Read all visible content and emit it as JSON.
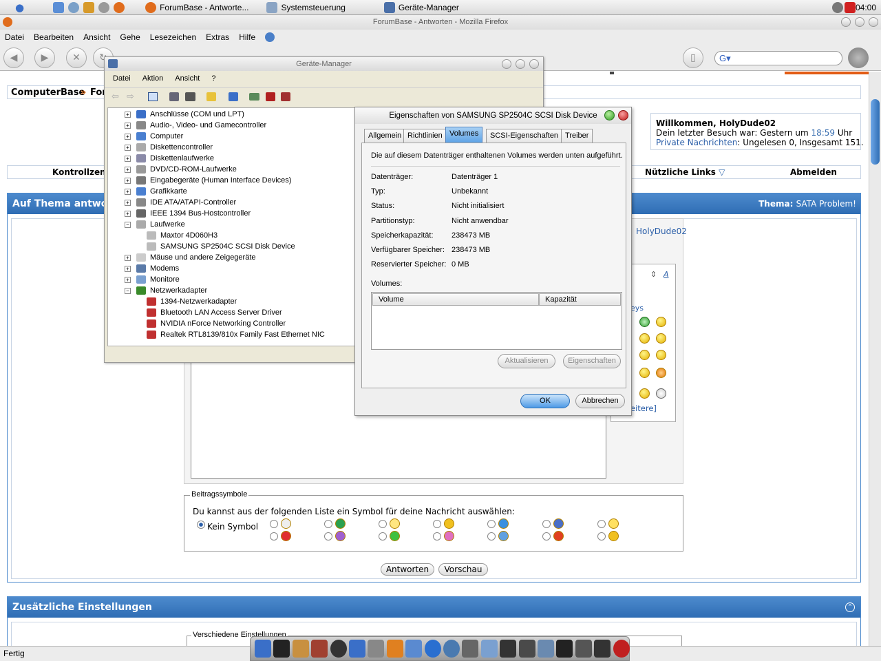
{
  "topbar": {
    "tasks": [
      "ForumBase - Antworte...",
      "Systemsteuerung",
      "Geräte-Manager"
    ],
    "clock": "04:00"
  },
  "firefox": {
    "title": "ForumBase - Antworten - Mozilla Firefox",
    "menu": [
      "Datei",
      "Bearbeiten",
      "Ansicht",
      "Gehe",
      "Lesezeichen",
      "Extras",
      "Hilfe"
    ],
    "status": "Fertig"
  },
  "forum": {
    "breadcrumb_site": "ComputerBase",
    "breadcrumb_sep": "»",
    "breadcrumb_next": "For",
    "welcome_title": "Willkommen, HolyDude02",
    "last_visit_prefix": "Dein letzter Besuch war: Gestern um ",
    "last_visit_time": "18:59",
    "last_visit_suffix": " Uhr",
    "pm_link": "Private Nachrichten",
    "pm_info": ": Ungelesen 0, Insgesamt 151.",
    "nav_left": "Kontrollzentr",
    "nav_links": "Nützliche Links",
    "nav_logout": "Abmelden",
    "reply_header": "Auf Thema antwor",
    "thema_label": "Thema:",
    "thema_value": "SATA Problem!",
    "user_link": "HolyDude02",
    "smilies_label": "eys",
    "more_link": "eitere]",
    "symbols_legend": "Beitragssymbole",
    "symbols_instruction": "Du kannst aus der folgenden Liste ein Symbol für deine Nachricht auswählen:",
    "no_symbol": "Kein Symbol",
    "reply_button": "Antworten",
    "preview_button": "Vorschau",
    "extra_settings": "Zusätzliche Einstellungen",
    "misc_settings": "Verschiedene Einstellungen"
  },
  "devmgr": {
    "title": "Geräte-Manager",
    "menu": [
      "Datei",
      "Aktion",
      "Ansicht",
      "?"
    ],
    "tree": [
      {
        "label": "Anschlüsse (COM und LPT)",
        "level": 0,
        "exp": "+"
      },
      {
        "label": "Audio-, Video- und Gamecontroller",
        "level": 0,
        "exp": "+"
      },
      {
        "label": "Computer",
        "level": 0,
        "exp": "+"
      },
      {
        "label": "Diskettencontroller",
        "level": 0,
        "exp": "+"
      },
      {
        "label": "Diskettenlaufwerke",
        "level": 0,
        "exp": "+"
      },
      {
        "label": "DVD/CD-ROM-Laufwerke",
        "level": 0,
        "exp": "+"
      },
      {
        "label": "Eingabegeräte (Human Interface Devices)",
        "level": 0,
        "exp": "+"
      },
      {
        "label": "Grafikkarte",
        "level": 0,
        "exp": "+"
      },
      {
        "label": "IDE ATA/ATAPI-Controller",
        "level": 0,
        "exp": "+"
      },
      {
        "label": "IEEE 1394 Bus-Hostcontroller",
        "level": 0,
        "exp": "+"
      },
      {
        "label": "Laufwerke",
        "level": 0,
        "exp": "−"
      },
      {
        "label": "Maxtor 4D060H3",
        "level": 1,
        "exp": ""
      },
      {
        "label": "SAMSUNG SP2504C SCSI Disk Device",
        "level": 1,
        "exp": ""
      },
      {
        "label": "Mäuse und andere Zeigegeräte",
        "level": 0,
        "exp": "+"
      },
      {
        "label": "Modems",
        "level": 0,
        "exp": "+"
      },
      {
        "label": "Monitore",
        "level": 0,
        "exp": "+"
      },
      {
        "label": "Netzwerkadapter",
        "level": 0,
        "exp": "−"
      },
      {
        "label": "1394-Netzwerkadapter",
        "level": 1,
        "exp": ""
      },
      {
        "label": "Bluetooth LAN Access Server Driver",
        "level": 1,
        "exp": ""
      },
      {
        "label": "NVIDIA nForce Networking Controller",
        "level": 1,
        "exp": ""
      },
      {
        "label": "Realtek RTL8139/810x Family Fast Ethernet NIC",
        "level": 1,
        "exp": ""
      }
    ]
  },
  "props": {
    "title": "Eigenschaften von SAMSUNG SP2504C SCSI Disk Device",
    "tabs": [
      "Allgemein",
      "Richtlinien",
      "Volumes",
      "SCSI-Eigenschaften",
      "Treiber"
    ],
    "intro": "Die auf diesem Datenträger enthaltenen Volumes werden unten aufgeführt.",
    "fields": [
      {
        "label": "Datenträger:",
        "value": "Datenträger 1"
      },
      {
        "label": "Typ:",
        "value": "Unbekannt"
      },
      {
        "label": "Status:",
        "value": "Nicht initialisiert"
      },
      {
        "label": "Partitionstyp:",
        "value": "Nicht anwendbar"
      },
      {
        "label": "Speicherkapazität:",
        "value": "238473 MB"
      },
      {
        "label": "Verfügbarer Speicher:",
        "value": "238473 MB"
      },
      {
        "label": "Reservierter Speicher:",
        "value": "0 MB"
      }
    ],
    "volumes_label": "Volumes:",
    "col_volume": "Volume",
    "col_capacity": "Kapazität",
    "refresh": "Aktualisieren",
    "properties": "Eigenschaften",
    "ok": "OK",
    "cancel": "Abbrechen"
  }
}
